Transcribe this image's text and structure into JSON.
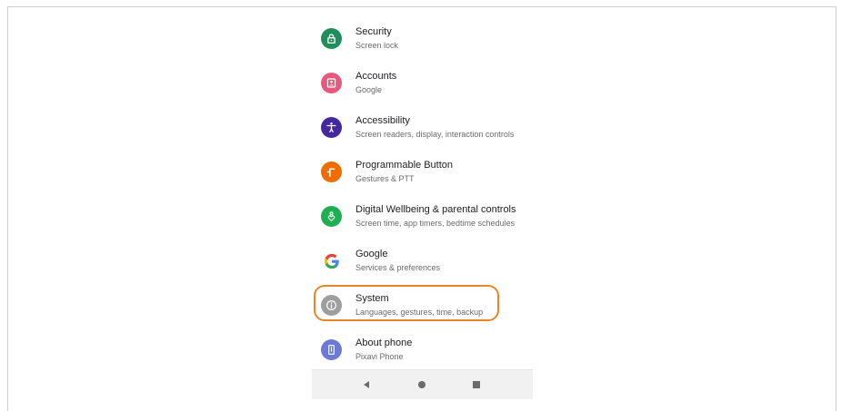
{
  "colors": {
    "security": "#1e8e5a",
    "accounts": "#e8587c",
    "accessibility": "#4527a0",
    "programmable": "#ef6c00",
    "wellbeing": "#1fae52",
    "google": "#ffffff",
    "system": "#9e9e9e",
    "about": "#6b7bd4",
    "highlight": "#e8862a"
  },
  "settings": {
    "items": [
      {
        "title": "Security",
        "subtitle": "Screen lock",
        "icon": "lock-icon"
      },
      {
        "title": "Accounts",
        "subtitle": "Google",
        "icon": "accounts-icon"
      },
      {
        "title": "Accessibility",
        "subtitle": "Screen readers, display, interaction controls",
        "icon": "accessibility-icon"
      },
      {
        "title": "Programmable Button",
        "subtitle": "Gestures & PTT",
        "icon": "programmable-button-icon"
      },
      {
        "title": "Digital Wellbeing & parental controls",
        "subtitle": "Screen time, app timers, bedtime schedules",
        "icon": "wellbeing-icon"
      },
      {
        "title": "Google",
        "subtitle": "Services & preferences",
        "icon": "google-icon"
      },
      {
        "title": "System",
        "subtitle": "Languages, gestures, time, backup",
        "icon": "info-icon"
      },
      {
        "title": "About phone",
        "subtitle": "Pixavi Phone",
        "icon": "phone-icon"
      }
    ]
  },
  "navbar": {
    "back": "back-icon",
    "home": "home-icon",
    "recents": "recents-icon"
  }
}
